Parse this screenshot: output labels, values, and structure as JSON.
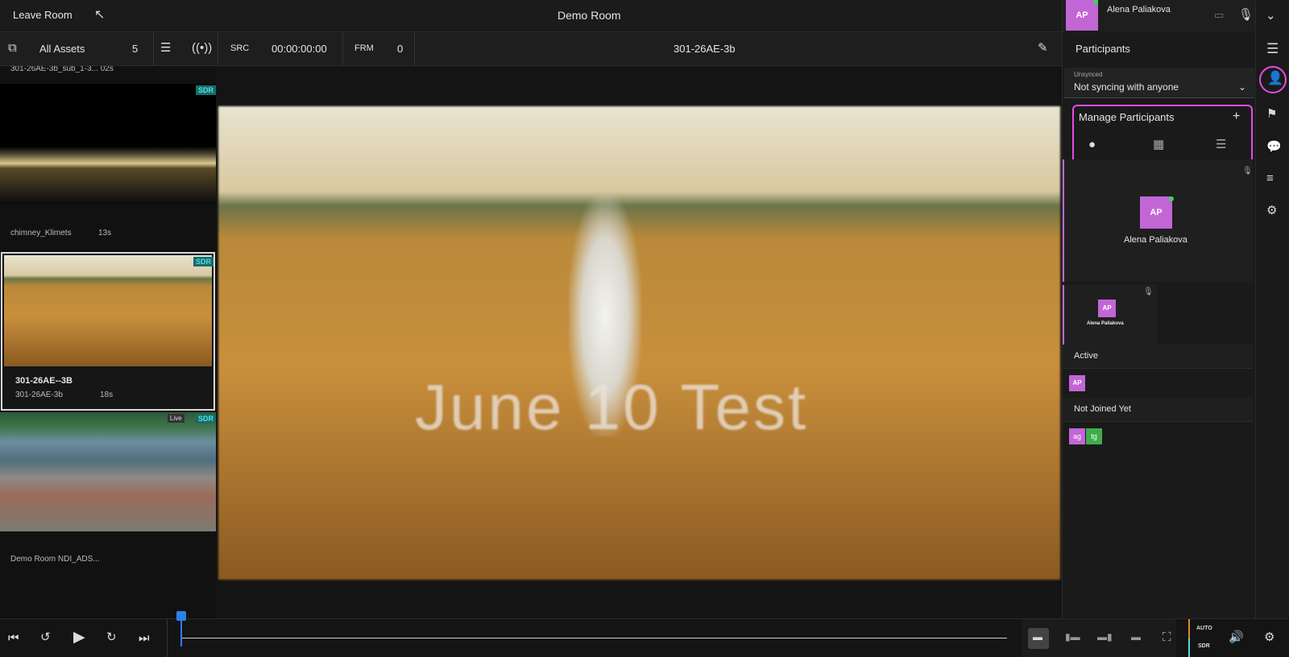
{
  "topbar": {
    "leave_label": "Leave Room",
    "room_title": "Demo Room"
  },
  "user": {
    "initials": "AP",
    "name": "Alena Paliakova"
  },
  "toolbar": {
    "assets_label": "All Assets",
    "assets_count": "5",
    "src_label": "SRC",
    "timecode": "00:00:00:00",
    "frm_label": "FRM",
    "frame": "0",
    "clip_title": "301-26AE-3b"
  },
  "assets": [
    {
      "name": "301-26AE-3b_sub_1-3... 02s",
      "badge": ""
    },
    {
      "name": "chimney_Klimets",
      "duration": "13s",
      "badge": "SDR"
    },
    {
      "title": "301-26AE--3B",
      "name": "301-26AE-3b",
      "duration": "18s",
      "badge": "SDR"
    },
    {
      "name": "Demo Room NDI_ADS...",
      "live": "Live",
      "badge": "SDR"
    }
  ],
  "viewer": {
    "overlay_text": "June 10 Test"
  },
  "panel": {
    "title": "Participants",
    "sync_status": "Unsynced",
    "sync_value": "Not syncing with anyone",
    "manage_title": "Manage Participants",
    "add_symbol": "+",
    "main_participant": {
      "initials": "AP",
      "name": "Alena Paliakova"
    },
    "small_participant": {
      "initials": "AP",
      "name": "Alena Paliakova"
    },
    "active_label": "Active",
    "active": [
      {
        "initials": "AP"
      }
    ],
    "not_joined_label": "Not Joined Yet",
    "not_joined": [
      {
        "initials": "ag",
        "color": "#c266d6"
      },
      {
        "initials": "tg",
        "color": "#3fae4a"
      }
    ]
  },
  "playback": {
    "auto_label": "AUTO",
    "sdr_label": "SDR",
    "progress": 0.0
  },
  "colors": {
    "accent": "#c266d6",
    "highlight": "#e64ce6",
    "sdr_teal": "#4ee0e0",
    "timeline_blue": "#2f7fe8"
  }
}
